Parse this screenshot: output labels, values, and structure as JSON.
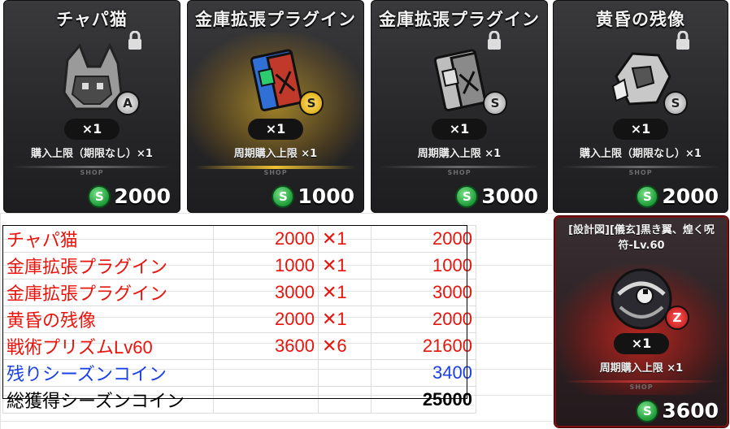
{
  "cards": [
    {
      "title": "チャパ猫",
      "qty": "×1",
      "limit": "購入上限（期限なし）×1",
      "shop": "SHOP",
      "price": "2000",
      "rank": "A",
      "coin": "S"
    },
    {
      "title": "金庫拡張プラグイン",
      "qty": "×1",
      "limit": "周期購入上限 ×1",
      "shop": "SHOP",
      "price": "1000",
      "rank": "S",
      "coin": "S"
    },
    {
      "title": "金庫拡張プラグイン",
      "qty": "×1",
      "limit": "周期購入上限 ×1",
      "shop": "SHOP",
      "price": "3000",
      "rank": "S",
      "coin": "S"
    },
    {
      "title": "黄昏の残像",
      "qty": "×1",
      "limit": "購入上限（期限なし）×1",
      "shop": "SHOP",
      "price": "2000",
      "rank": "S",
      "coin": "S"
    },
    {
      "title": "[設計図][儀玄]黒き翼、煌く呪符-Lv.60",
      "qty": "×1",
      "limit": "周期購入上限 ×1",
      "shop": "SHOP",
      "price": "3600",
      "rank": "Z",
      "coin": "S"
    }
  ],
  "sheet": {
    "rows": [
      {
        "name": "チャパ猫",
        "price": "2000",
        "mul": "✕1",
        "total": "2000"
      },
      {
        "name": "金庫拡張プラグイン",
        "price": "1000",
        "mul": "✕1",
        "total": "1000"
      },
      {
        "name": "金庫拡張プラグイン",
        "price": "3000",
        "mul": "✕1",
        "total": "3000"
      },
      {
        "name": "黄昏の残像",
        "price": "2000",
        "mul": "✕1",
        "total": "2000"
      },
      {
        "name": "戦術プリズムLv60",
        "price": "3600",
        "mul": "✕6",
        "total": "21600"
      }
    ],
    "remaining": {
      "label": "残りシーズンコイン",
      "value": "3400"
    },
    "total": {
      "label": "総獲得シーズンコイン",
      "value": "25000"
    }
  },
  "colors": {
    "red_text": "#e8140c",
    "blue_text": "#1a3fe8",
    "coin_green": "#1e9b39",
    "gold_glow": "#f1c232",
    "red_glow": "#d21a10"
  }
}
